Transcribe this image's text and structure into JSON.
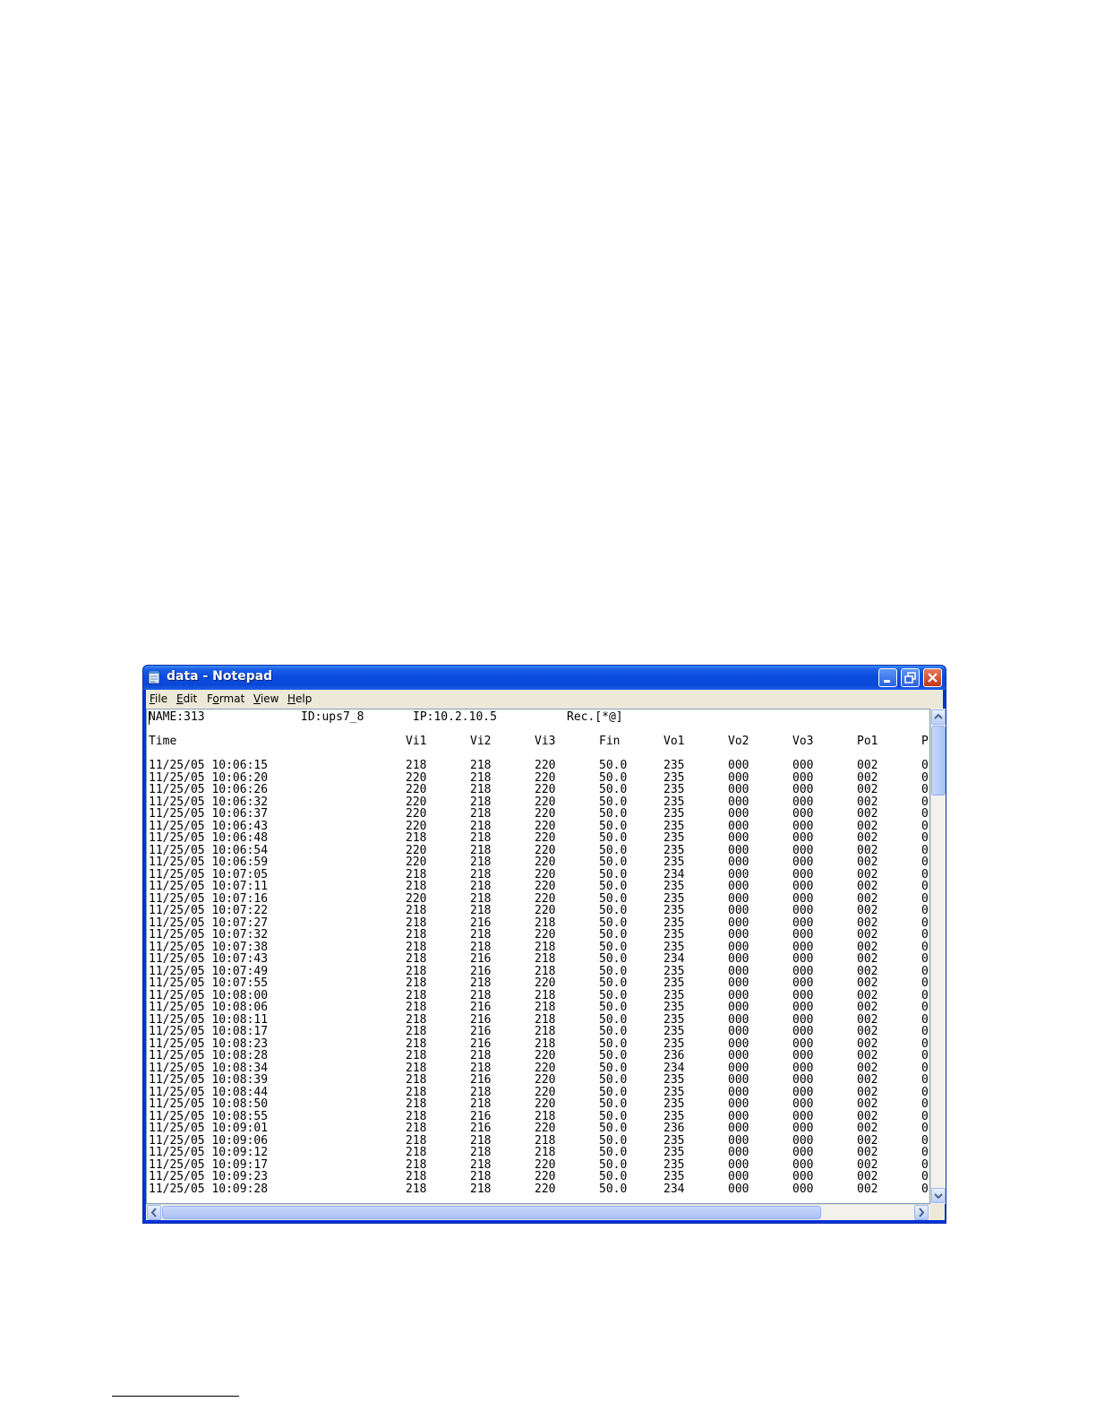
{
  "window": {
    "title": "data - Notepad",
    "icon": "notepad-icon"
  },
  "menu": {
    "items": [
      {
        "label": "File",
        "key": "F",
        "rest": "ile"
      },
      {
        "label": "Edit",
        "key": "E",
        "rest": "dit"
      },
      {
        "label": "Format",
        "pre": "F",
        "key": "o",
        "rest": "rmat"
      },
      {
        "label": "View",
        "key": "V",
        "rest": "iew"
      },
      {
        "label": "Help",
        "key": "H",
        "rest": "elp"
      }
    ]
  },
  "document": {
    "header": {
      "name": "NAME:313",
      "id": "ID:ups7_8",
      "ip": "IP:10.2.10.5",
      "rec": "Rec.[*@]"
    },
    "columns": [
      "Time",
      "Vi1",
      "Vi2",
      "Vi3",
      "Fin",
      "Vo1",
      "Vo2",
      "Vo3",
      "Po1",
      "P"
    ],
    "rows": [
      [
        "11/25/05 10:06:15",
        "218",
        "218",
        "220",
        "50.0",
        "235",
        "000",
        "000",
        "002",
        "0"
      ],
      [
        "11/25/05 10:06:20",
        "220",
        "218",
        "220",
        "50.0",
        "235",
        "000",
        "000",
        "002",
        "0"
      ],
      [
        "11/25/05 10:06:26",
        "220",
        "218",
        "220",
        "50.0",
        "235",
        "000",
        "000",
        "002",
        "0"
      ],
      [
        "11/25/05 10:06:32",
        "220",
        "218",
        "220",
        "50.0",
        "235",
        "000",
        "000",
        "002",
        "0"
      ],
      [
        "11/25/05 10:06:37",
        "220",
        "218",
        "220",
        "50.0",
        "235",
        "000",
        "000",
        "002",
        "0"
      ],
      [
        "11/25/05 10:06:43",
        "220",
        "218",
        "220",
        "50.0",
        "235",
        "000",
        "000",
        "002",
        "0"
      ],
      [
        "11/25/05 10:06:48",
        "218",
        "218",
        "220",
        "50.0",
        "235",
        "000",
        "000",
        "002",
        "0"
      ],
      [
        "11/25/05 10:06:54",
        "220",
        "218",
        "220",
        "50.0",
        "235",
        "000",
        "000",
        "002",
        "0"
      ],
      [
        "11/25/05 10:06:59",
        "220",
        "218",
        "220",
        "50.0",
        "235",
        "000",
        "000",
        "002",
        "0"
      ],
      [
        "11/25/05 10:07:05",
        "218",
        "218",
        "220",
        "50.0",
        "234",
        "000",
        "000",
        "002",
        "0"
      ],
      [
        "11/25/05 10:07:11",
        "218",
        "218",
        "220",
        "50.0",
        "235",
        "000",
        "000",
        "002",
        "0"
      ],
      [
        "11/25/05 10:07:16",
        "220",
        "218",
        "220",
        "50.0",
        "235",
        "000",
        "000",
        "002",
        "0"
      ],
      [
        "11/25/05 10:07:22",
        "218",
        "218",
        "220",
        "50.0",
        "235",
        "000",
        "000",
        "002",
        "0"
      ],
      [
        "11/25/05 10:07:27",
        "218",
        "216",
        "218",
        "50.0",
        "235",
        "000",
        "000",
        "002",
        "0"
      ],
      [
        "11/25/05 10:07:32",
        "218",
        "218",
        "220",
        "50.0",
        "235",
        "000",
        "000",
        "002",
        "0"
      ],
      [
        "11/25/05 10:07:38",
        "218",
        "218",
        "218",
        "50.0",
        "235",
        "000",
        "000",
        "002",
        "0"
      ],
      [
        "11/25/05 10:07:43",
        "218",
        "216",
        "218",
        "50.0",
        "234",
        "000",
        "000",
        "002",
        "0"
      ],
      [
        "11/25/05 10:07:49",
        "218",
        "216",
        "218",
        "50.0",
        "235",
        "000",
        "000",
        "002",
        "0"
      ],
      [
        "11/25/05 10:07:55",
        "218",
        "218",
        "220",
        "50.0",
        "235",
        "000",
        "000",
        "002",
        "0"
      ],
      [
        "11/25/05 10:08:00",
        "218",
        "218",
        "218",
        "50.0",
        "235",
        "000",
        "000",
        "002",
        "0"
      ],
      [
        "11/25/05 10:08:06",
        "218",
        "216",
        "218",
        "50.0",
        "235",
        "000",
        "000",
        "002",
        "0"
      ],
      [
        "11/25/05 10:08:11",
        "218",
        "216",
        "218",
        "50.0",
        "235",
        "000",
        "000",
        "002",
        "0"
      ],
      [
        "11/25/05 10:08:17",
        "218",
        "216",
        "218",
        "50.0",
        "235",
        "000",
        "000",
        "002",
        "0"
      ],
      [
        "11/25/05 10:08:23",
        "218",
        "216",
        "218",
        "50.0",
        "235",
        "000",
        "000",
        "002",
        "0"
      ],
      [
        "11/25/05 10:08:28",
        "218",
        "218",
        "220",
        "50.0",
        "236",
        "000",
        "000",
        "002",
        "0"
      ],
      [
        "11/25/05 10:08:34",
        "218",
        "218",
        "220",
        "50.0",
        "234",
        "000",
        "000",
        "002",
        "0"
      ],
      [
        "11/25/05 10:08:39",
        "218",
        "216",
        "220",
        "50.0",
        "235",
        "000",
        "000",
        "002",
        "0"
      ],
      [
        "11/25/05 10:08:44",
        "218",
        "218",
        "220",
        "50.0",
        "235",
        "000",
        "000",
        "002",
        "0"
      ],
      [
        "11/25/05 10:08:50",
        "218",
        "218",
        "220",
        "50.0",
        "235",
        "000",
        "000",
        "002",
        "0"
      ],
      [
        "11/25/05 10:08:55",
        "218",
        "216",
        "218",
        "50.0",
        "235",
        "000",
        "000",
        "002",
        "0"
      ],
      [
        "11/25/05 10:09:01",
        "218",
        "216",
        "220",
        "50.0",
        "236",
        "000",
        "000",
        "002",
        "0"
      ],
      [
        "11/25/05 10:09:06",
        "218",
        "218",
        "218",
        "50.0",
        "235",
        "000",
        "000",
        "002",
        "0"
      ],
      [
        "11/25/05 10:09:12",
        "218",
        "218",
        "218",
        "50.0",
        "235",
        "000",
        "000",
        "002",
        "0"
      ],
      [
        "11/25/05 10:09:17",
        "218",
        "218",
        "220",
        "50.0",
        "235",
        "000",
        "000",
        "002",
        "0"
      ],
      [
        "11/25/05 10:09:23",
        "218",
        "218",
        "220",
        "50.0",
        "235",
        "000",
        "000",
        "002",
        "0"
      ],
      [
        "11/25/05 10:09:28",
        "218",
        "218",
        "220",
        "50.0",
        "234",
        "000",
        "000",
        "002",
        "0"
      ]
    ]
  },
  "icons": {
    "minimize": "minimize-icon",
    "restore": "restore-icon",
    "close": "close-icon",
    "scroll_up": "arrow-up-icon",
    "scroll_down": "arrow-down-icon",
    "scroll_left": "arrow-left-icon",
    "scroll_right": "arrow-right-icon"
  },
  "colors": {
    "titlebar": "#0b4ce0",
    "close_button": "#c3351a",
    "menubar": "#ece9d8",
    "scrollbar_thumb": "#a9c2f5"
  }
}
